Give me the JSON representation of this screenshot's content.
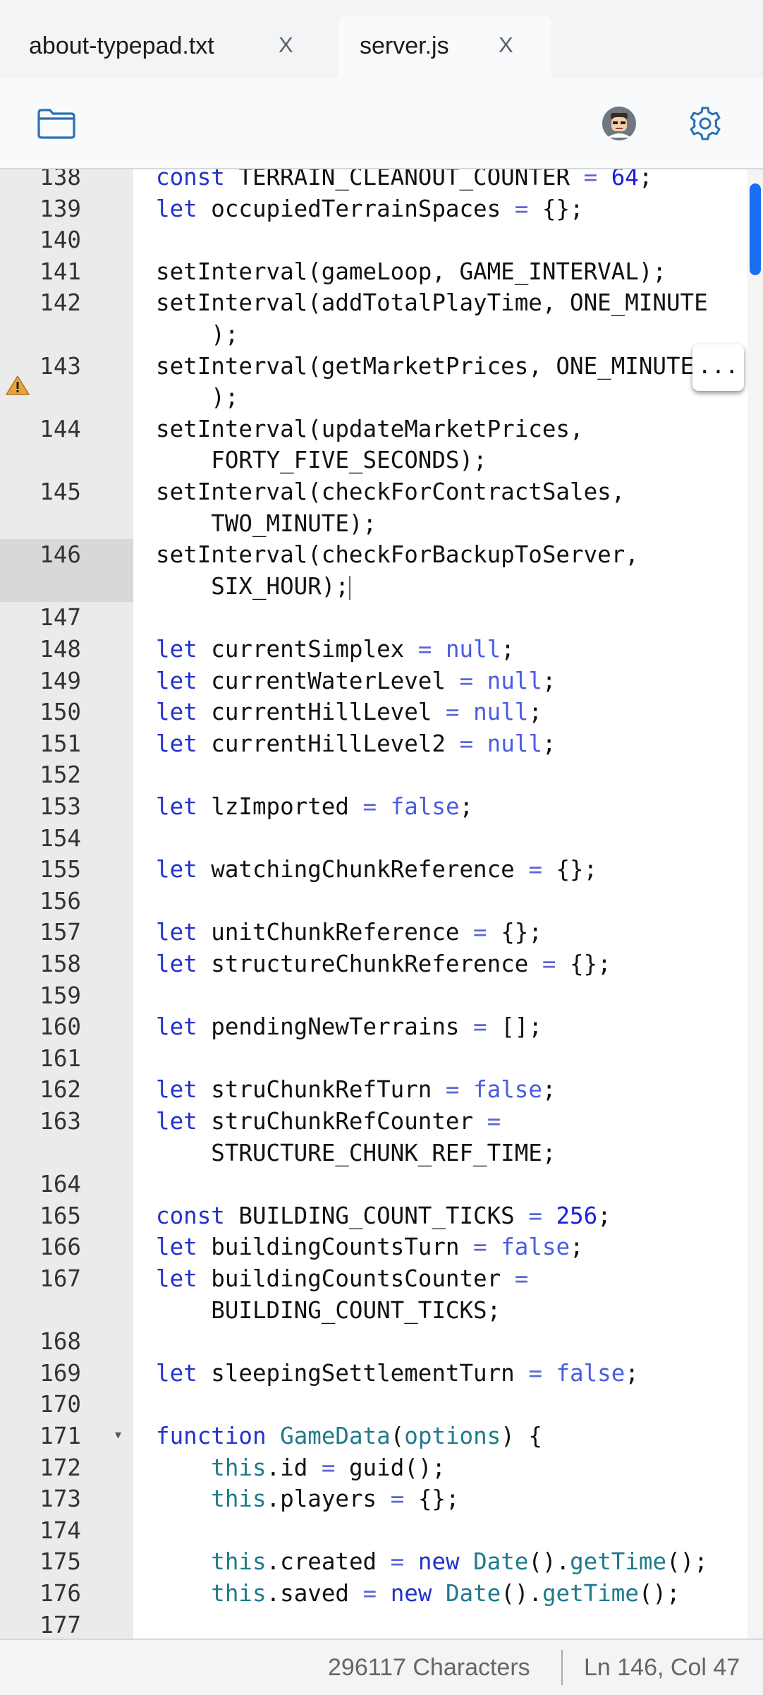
{
  "tabs": [
    {
      "label": "about-typepad.txt",
      "close": "X",
      "active": false
    },
    {
      "label": "server.js",
      "close": "X",
      "active": true
    }
  ],
  "toolbar": {
    "folder_icon": "folder-icon",
    "avatar_icon": "avatar",
    "settings_icon": "gear-icon"
  },
  "editor": {
    "more_label": "...",
    "lines": [
      {
        "n": "138"
      },
      {
        "n": "139"
      },
      {
        "n": "140"
      },
      {
        "n": "141"
      },
      {
        "n": "142"
      },
      {
        "n": "143",
        "warning": true
      },
      {
        "n": "144"
      },
      {
        "n": "145"
      },
      {
        "n": "146",
        "active": true
      },
      {
        "n": "147"
      },
      {
        "n": "148"
      },
      {
        "n": "149"
      },
      {
        "n": "150"
      },
      {
        "n": "151"
      },
      {
        "n": "152"
      },
      {
        "n": "153"
      },
      {
        "n": "154"
      },
      {
        "n": "155"
      },
      {
        "n": "156"
      },
      {
        "n": "157"
      },
      {
        "n": "158"
      },
      {
        "n": "159"
      },
      {
        "n": "160"
      },
      {
        "n": "161"
      },
      {
        "n": "162"
      },
      {
        "n": "163"
      },
      {
        "n": "164"
      },
      {
        "n": "165"
      },
      {
        "n": "166"
      },
      {
        "n": "167"
      },
      {
        "n": "168"
      },
      {
        "n": "169"
      },
      {
        "n": "170"
      },
      {
        "n": "171",
        "fold": true
      },
      {
        "n": "172"
      },
      {
        "n": "173"
      },
      {
        "n": "174"
      },
      {
        "n": "175"
      },
      {
        "n": "176"
      },
      {
        "n": "177"
      }
    ],
    "code": {
      "l138": [
        [
          "k",
          "const"
        ],
        [
          "t",
          " TERRAIN_CLEANOUT_COUNTER "
        ],
        [
          "o",
          "="
        ],
        [
          "t",
          " "
        ],
        [
          "n",
          "64"
        ],
        [
          "t",
          ";"
        ]
      ],
      "l139": [
        [
          "k",
          "let"
        ],
        [
          "t",
          " occupiedTerrainSpaces "
        ],
        [
          "o",
          "="
        ],
        [
          "t",
          " {};"
        ]
      ],
      "l140": [],
      "l141": [
        [
          "t",
          "setInterval(gameLoop, GAME_INTERVAL);"
        ]
      ],
      "l142": [
        [
          "t",
          "setInterval(addTotalPlayTime, ONE_MINUTE\n    );"
        ]
      ],
      "l143": [
        [
          "t",
          "setInterval(getMarketPrices, ONE_MINUTE\n    );"
        ]
      ],
      "l144": [
        [
          "t",
          "setInterval(updateMarketPrices,\n    FORTY_FIVE_SECONDS);"
        ]
      ],
      "l145": [
        [
          "t",
          "setInterval(checkForContractSales,\n    TWO_MINUTE);"
        ]
      ],
      "l146": [
        [
          "t",
          "setInterval(checkForBackupToServer,\n    SIX_HOUR);"
        ]
      ],
      "l147": [],
      "l148": [
        [
          "k",
          "let"
        ],
        [
          "t",
          " currentSimplex "
        ],
        [
          "o",
          "="
        ],
        [
          "t",
          " "
        ],
        [
          "v",
          "null"
        ],
        [
          "t",
          ";"
        ]
      ],
      "l149": [
        [
          "k",
          "let"
        ],
        [
          "t",
          " currentWaterLevel "
        ],
        [
          "o",
          "="
        ],
        [
          "t",
          " "
        ],
        [
          "v",
          "null"
        ],
        [
          "t",
          ";"
        ]
      ],
      "l150": [
        [
          "k",
          "let"
        ],
        [
          "t",
          " currentHillLevel "
        ],
        [
          "o",
          "="
        ],
        [
          "t",
          " "
        ],
        [
          "v",
          "null"
        ],
        [
          "t",
          ";"
        ]
      ],
      "l151": [
        [
          "k",
          "let"
        ],
        [
          "t",
          " currentHillLevel2 "
        ],
        [
          "o",
          "="
        ],
        [
          "t",
          " "
        ],
        [
          "v",
          "null"
        ],
        [
          "t",
          ";"
        ]
      ],
      "l152": [],
      "l153": [
        [
          "k",
          "let"
        ],
        [
          "t",
          " lzImported "
        ],
        [
          "o",
          "="
        ],
        [
          "t",
          " "
        ],
        [
          "v",
          "false"
        ],
        [
          "t",
          ";"
        ]
      ],
      "l154": [],
      "l155": [
        [
          "k",
          "let"
        ],
        [
          "t",
          " watchingChunkReference "
        ],
        [
          "o",
          "="
        ],
        [
          "t",
          " {};"
        ]
      ],
      "l156": [],
      "l157": [
        [
          "k",
          "let"
        ],
        [
          "t",
          " unitChunkReference "
        ],
        [
          "o",
          "="
        ],
        [
          "t",
          " {};"
        ]
      ],
      "l158": [
        [
          "k",
          "let"
        ],
        [
          "t",
          " structureChunkReference "
        ],
        [
          "o",
          "="
        ],
        [
          "t",
          " {};"
        ]
      ],
      "l159": [],
      "l160": [
        [
          "k",
          "let"
        ],
        [
          "t",
          " pendingNewTerrains "
        ],
        [
          "o",
          "="
        ],
        [
          "t",
          " [];"
        ]
      ],
      "l161": [],
      "l162": [
        [
          "k",
          "let"
        ],
        [
          "t",
          " struChunkRefTurn "
        ],
        [
          "o",
          "="
        ],
        [
          "t",
          " "
        ],
        [
          "v",
          "false"
        ],
        [
          "t",
          ";"
        ]
      ],
      "l163": [
        [
          "k",
          "let"
        ],
        [
          "t",
          " struChunkRefCounter "
        ],
        [
          "o",
          "="
        ],
        [
          "t",
          "\n    STRUCTURE_CHUNK_REF_TIME;"
        ]
      ],
      "l164": [],
      "l165": [
        [
          "k",
          "const"
        ],
        [
          "t",
          " BUILDING_COUNT_TICKS "
        ],
        [
          "o",
          "="
        ],
        [
          "t",
          " "
        ],
        [
          "n",
          "256"
        ],
        [
          "t",
          ";"
        ]
      ],
      "l166": [
        [
          "k",
          "let"
        ],
        [
          "t",
          " buildingCountsTurn "
        ],
        [
          "o",
          "="
        ],
        [
          "t",
          " "
        ],
        [
          "v",
          "false"
        ],
        [
          "t",
          ";"
        ]
      ],
      "l167": [
        [
          "k",
          "let"
        ],
        [
          "t",
          " buildingCountsCounter "
        ],
        [
          "o",
          "="
        ],
        [
          "t",
          "\n    BUILDING_COUNT_TICKS;"
        ]
      ],
      "l168": [],
      "l169": [
        [
          "k",
          "let"
        ],
        [
          "t",
          " sleepingSettlementTurn "
        ],
        [
          "o",
          "="
        ],
        [
          "t",
          " "
        ],
        [
          "v",
          "false"
        ],
        [
          "t",
          ";"
        ]
      ],
      "l170": [],
      "l171": [
        [
          "k",
          "function"
        ],
        [
          "t",
          " "
        ],
        [
          "c",
          "GameData"
        ],
        [
          "t",
          "("
        ],
        [
          "c",
          "options"
        ],
        [
          "t",
          ") {"
        ]
      ],
      "l172": [
        [
          "t",
          "    "
        ],
        [
          "c",
          "this"
        ],
        [
          "t",
          ".id "
        ],
        [
          "o",
          "="
        ],
        [
          "t",
          " guid();"
        ]
      ],
      "l173": [
        [
          "t",
          "    "
        ],
        [
          "c",
          "this"
        ],
        [
          "t",
          ".players "
        ],
        [
          "o",
          "="
        ],
        [
          "t",
          " {};"
        ]
      ],
      "l174": [],
      "l175": [
        [
          "t",
          "    "
        ],
        [
          "c",
          "this"
        ],
        [
          "t",
          ".created "
        ],
        [
          "o",
          "="
        ],
        [
          "t",
          " "
        ],
        [
          "k",
          "new"
        ],
        [
          "t",
          " "
        ],
        [
          "c",
          "Date"
        ],
        [
          "t",
          "()."
        ],
        [
          "c",
          "getTime"
        ],
        [
          "t",
          "();"
        ]
      ],
      "l176": [
        [
          "t",
          "    "
        ],
        [
          "c",
          "this"
        ],
        [
          "t",
          ".saved "
        ],
        [
          "o",
          "="
        ],
        [
          "t",
          " "
        ],
        [
          "k",
          "new"
        ],
        [
          "t",
          " "
        ],
        [
          "c",
          "Date"
        ],
        [
          "t",
          "()."
        ],
        [
          "c",
          "getTime"
        ],
        [
          "t",
          "();"
        ]
      ],
      "l177": []
    }
  },
  "status": {
    "characters": "296117 Characters",
    "position": "Ln 146, Col 47"
  }
}
